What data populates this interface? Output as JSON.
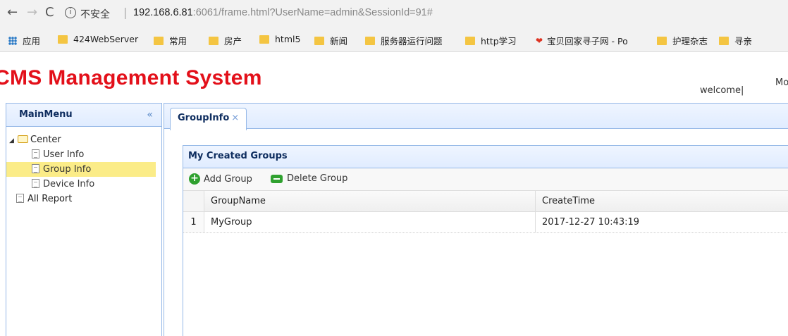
{
  "browser": {
    "insecure_label": "不安全",
    "url_host": "192.168.6.81",
    "url_rest": ":6061/frame.html?UserName=admin&SessionId=91#",
    "bookmarks": [
      "应用",
      "424WebServer",
      "常用",
      "房产",
      "html5",
      "新闻",
      "服务器运行问题",
      "http学习",
      "宝贝回家寻子网 - Po",
      "护理杂志",
      "寻亲"
    ]
  },
  "header": {
    "title": "CMS Management System",
    "welcome": "welcome|",
    "more": "Mo"
  },
  "menu": {
    "title": "MainMenu",
    "collapse_glyph": "«",
    "center": "Center",
    "items": [
      "User Info",
      "Group Info",
      "Device Info"
    ],
    "all_report": "All Report"
  },
  "tabs": [
    {
      "label": "GroupInfo",
      "close": "×"
    }
  ],
  "panel": {
    "title": "My Created Groups",
    "add_label": "Add Group",
    "delete_label": "Delete Group",
    "columns": [
      "GroupName",
      "CreateTime"
    ],
    "rows": [
      {
        "num": "1",
        "name": "MyGroup",
        "time": "2017-12-27 10:43:19"
      }
    ]
  },
  "colors": {
    "title_red": "#e3101a",
    "panel_border": "#95b8e7",
    "selected": "#fbec88"
  }
}
